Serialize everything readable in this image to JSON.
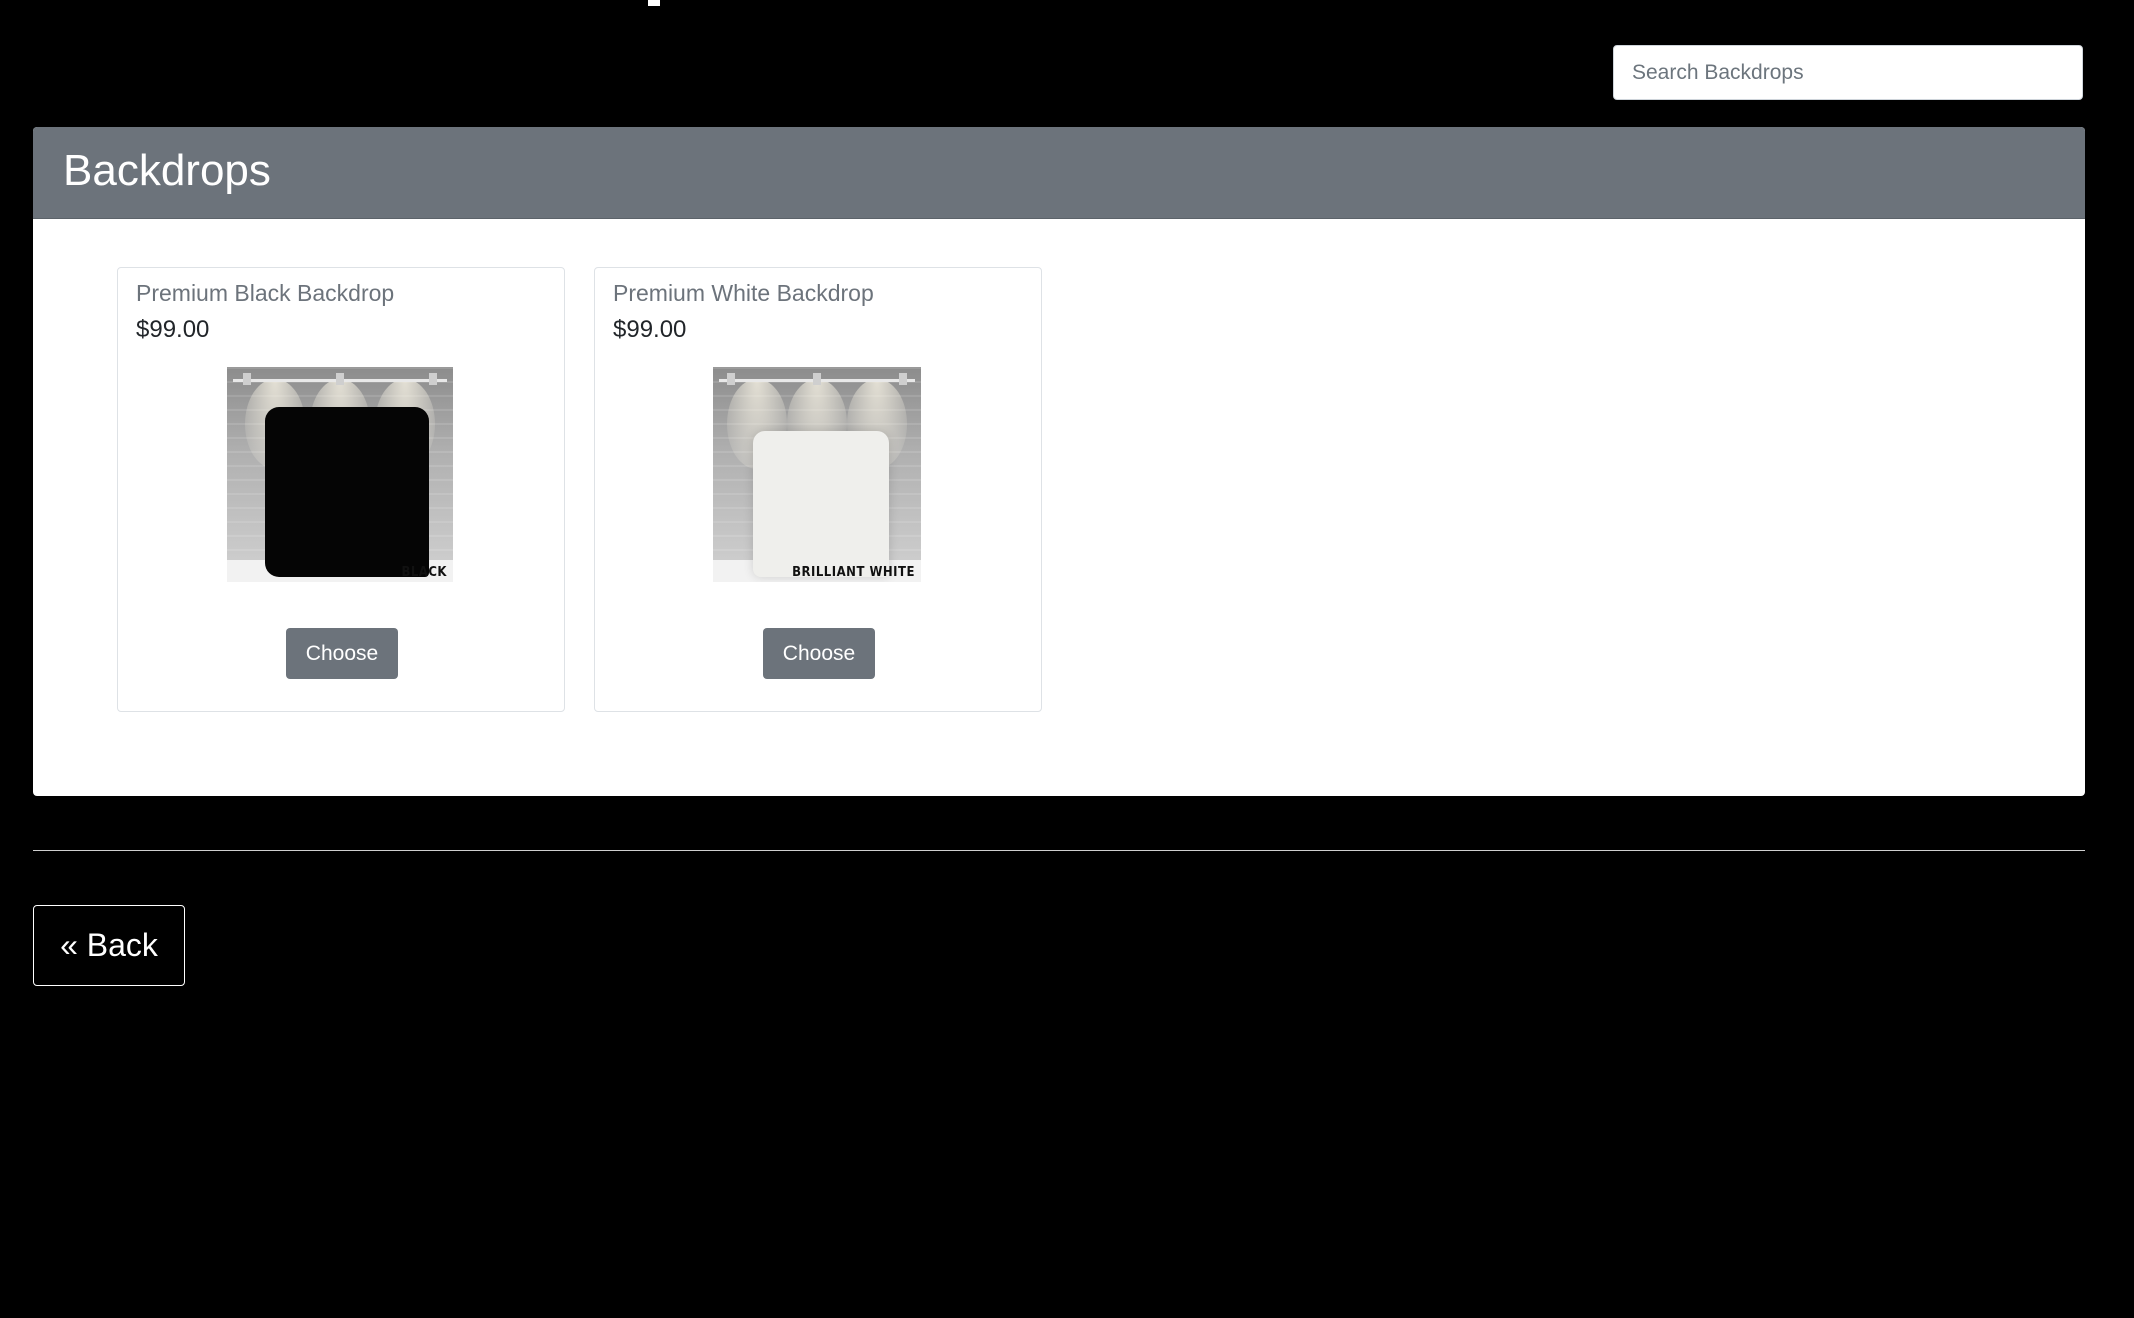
{
  "search": {
    "placeholder": "Search Backdrops",
    "value": ""
  },
  "panel": {
    "title": "Backdrops"
  },
  "products": [
    {
      "name": "Premium Black Backdrop",
      "price": "$99.00",
      "image_label": "BLACK",
      "choose_label": "Choose",
      "swatch_color": "#050505"
    },
    {
      "name": "Premium White Backdrop",
      "price": "$99.00",
      "image_label": "BRILLIANT WHITE",
      "choose_label": "Choose",
      "swatch_color": "#efefec"
    }
  ],
  "footer": {
    "back_label": "« Back"
  },
  "colors": {
    "page_background": "#000000",
    "panel_header": "#6c737b",
    "button": "#6c737b"
  }
}
